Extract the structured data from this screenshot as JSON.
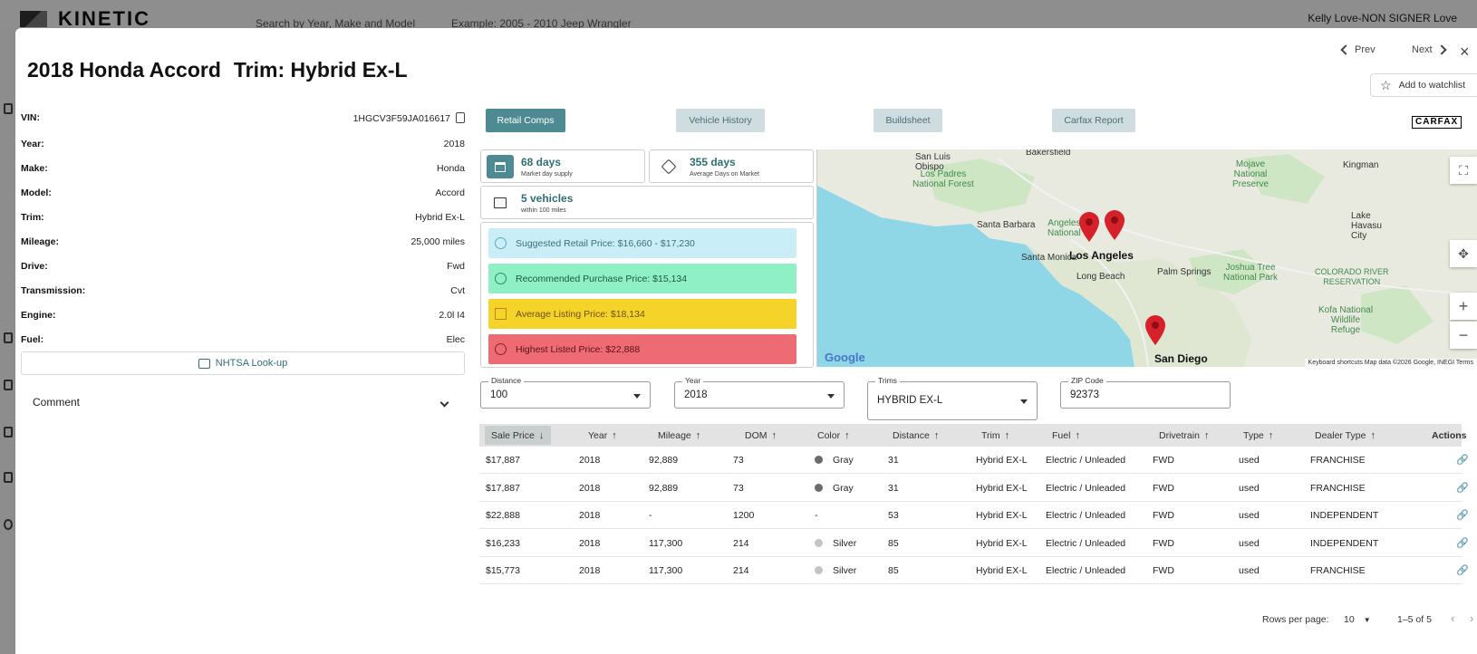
{
  "app": {
    "logo_text": "KINETIC",
    "search_placeholder": "Search by Year, Make and Model",
    "search_example": "Example: 2005 - 2010 Jeep Wrangler",
    "user": "Kelly Love-NON SIGNER Love"
  },
  "modal": {
    "title_vehicle": "2018 Honda Accord",
    "title_trim": "Trim: Hybrid Ex-L",
    "prev": "Prev",
    "next": "Next",
    "close": "×",
    "watchlist": "Add to watchlist"
  },
  "specs": [
    {
      "key": "VIN:",
      "value": "1HGCV3F59JA016617"
    },
    {
      "key": "Year:",
      "value": "2018"
    },
    {
      "key": "Make:",
      "value": "Honda"
    },
    {
      "key": "Model:",
      "value": "Accord"
    },
    {
      "key": "Trim:",
      "value": "Hybrid Ex-L"
    },
    {
      "key": "Mileage:",
      "value": "25,000 miles"
    },
    {
      "key": "Drive:",
      "value": "Fwd"
    },
    {
      "key": "Transmission:",
      "value": "Cvt"
    },
    {
      "key": "Engine:",
      "value": "2.0l I4"
    },
    {
      "key": "Fuel:",
      "value": "Elec"
    }
  ],
  "nhtsa_label": "NHTSA Look-up",
  "comment_label": "Comment",
  "tabs": [
    "Retail Comps",
    "Vehicle History",
    "Buildsheet",
    "Carfax Report"
  ],
  "carfax_logo": "CARFAX",
  "stats": {
    "market_days": "68 days",
    "market_days_label": "Market day supply",
    "avg_days": "355 days",
    "avg_days_label": "Average Days on Market",
    "vehicles": "5 vehicles",
    "vehicles_label": "within 100 miles"
  },
  "prices": {
    "suggested": "Suggested Retail Price: $16,660 - $17,230",
    "recommended": "Recommended Purchase Price: $15,134",
    "average": "Average Listing Price: $18,134",
    "highest": "Highest Listed Price: $22,888"
  },
  "colors": {
    "teal": "#4d8a92",
    "suggested_bg": "#c9eef8",
    "recommended_bg": "#8ff0c6",
    "average_bg": "#f5d328",
    "highest_bg": "#ee6b73",
    "pin": "#d6202a",
    "water": "#8fd6e6"
  },
  "map": {
    "labels": {
      "bakersfield": "Bakersfield",
      "san_luis_obispo": "San Luis\nObispo",
      "los_padres": "Los Padres\nNational Forest",
      "mojave": "Mojave\nNational\nPreserve",
      "kingman": "Kingman",
      "santa_barbara": "Santa Barbara",
      "angeles": "Angeles\nNational",
      "los_angeles": "Los Angeles",
      "santa_monica": "Santa Monica",
      "long_beach": "Long Beach",
      "palm_springs": "Palm Springs",
      "joshua_tree": "Joshua Tree\nNational Park",
      "colorado_river": "COLORADO RIVER\nRESERVATION",
      "lake_havasu": "Lake\nHavasu\nCity",
      "kofa": "Kofa National\nWildlife\nRefuge",
      "san_diego": "San Diego"
    },
    "google": "Google",
    "attribution": "Keyboard shortcuts   Map data ©2026 Google, INEGI   Terms"
  },
  "filters": {
    "distance_label": "Distance",
    "distance_value": "100",
    "year_label": "Year",
    "year_value": "2018",
    "trims_label": "Trims",
    "trims_value": "HYBRID EX-L",
    "zip_label": "ZIP Code",
    "zip_value": "92373"
  },
  "table": {
    "headers": [
      "Sale Price",
      "Year",
      "Mileage",
      "DOM",
      "Color",
      "Distance",
      "Trim",
      "Fuel",
      "Drivetrain",
      "Type",
      "Dealer Type",
      "Actions"
    ],
    "rows": [
      {
        "price": "$17,887",
        "year": "2018",
        "mileage": "92,889",
        "dom": "73",
        "color": "Gray",
        "color_hex": "#6b6b6b",
        "distance": "31",
        "trim": "Hybrid EX-L",
        "fuel": "Electric / Unleaded",
        "drive": "FWD",
        "type": "used",
        "dealer": "FRANCHISE"
      },
      {
        "price": "$17,887",
        "year": "2018",
        "mileage": "92,889",
        "dom": "73",
        "color": "Gray",
        "color_hex": "#6b6b6b",
        "distance": "31",
        "trim": "Hybrid EX-L",
        "fuel": "Electric / Unleaded",
        "drive": "FWD",
        "type": "used",
        "dealer": "FRANCHISE"
      },
      {
        "price": "$22,888",
        "year": "2018",
        "mileage": "-",
        "dom": "1200",
        "color": "-",
        "color_hex": "",
        "distance": "53",
        "trim": "Hybrid EX-L",
        "fuel": "Electric / Unleaded",
        "drive": "FWD",
        "type": "used",
        "dealer": "INDEPENDENT"
      },
      {
        "price": "$16,233",
        "year": "2018",
        "mileage": "117,300",
        "dom": "214",
        "color": "Silver",
        "color_hex": "#c4c4c4",
        "distance": "85",
        "trim": "Hybrid EX-L",
        "fuel": "Electric / Unleaded",
        "drive": "FWD",
        "type": "used",
        "dealer": "INDEPENDENT"
      },
      {
        "price": "$15,773",
        "year": "2018",
        "mileage": "117,300",
        "dom": "214",
        "color": "Silver",
        "color_hex": "#c4c4c4",
        "distance": "85",
        "trim": "Hybrid EX-L",
        "fuel": "Electric / Unleaded",
        "drive": "FWD",
        "type": "used",
        "dealer": "FRANCHISE"
      }
    ]
  },
  "pagination": {
    "rows_per_page_label": "Rows per page:",
    "rows_per_page_value": "10",
    "range": "1–5 of 5"
  }
}
